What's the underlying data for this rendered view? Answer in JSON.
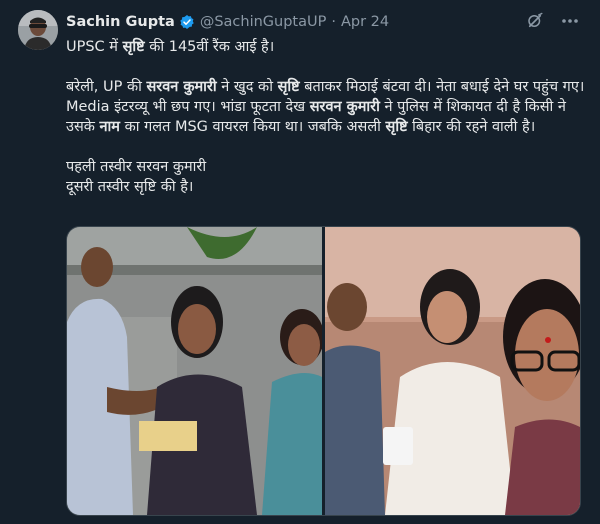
{
  "tweet": {
    "author_name": "Sachin Gupta",
    "handle": "@SachinGuptaUP",
    "separator": "·",
    "date": "Apr 24",
    "line1_a": "UPSC में ",
    "line1_b": "सृष्टि",
    "line1_c": " की 145वीं रैंक आई है।",
    "p2": [
      {
        "t": "बरेली, UP की ",
        "b": false
      },
      {
        "t": "सरवन कुमारी",
        "b": true
      },
      {
        "t": " ने खुद को ",
        "b": false
      },
      {
        "t": "सृष्टि",
        "b": true
      },
      {
        "t": " बताकर मिठाई बंटवा दी। नेता बधाई देने घर पहुंच गए। Media इंटरव्यू भी छप गए। भांडा फूटता देख ",
        "b": false
      },
      {
        "t": "सरवन कुमारी",
        "b": true
      },
      {
        "t": " ने पुलिस में शिकायत दी है किसी ने उसके ",
        "b": false
      },
      {
        "t": "नाम",
        "b": true
      },
      {
        "t": " का गलत MSG वायरल किया था। जबकि असली ",
        "b": false
      },
      {
        "t": "सृष्टि",
        "b": true
      },
      {
        "t": " बिहार की रहने वाली है।",
        "b": false
      }
    ],
    "line3": "पहली तस्वीर सरवन कुमारी",
    "line4": "दूसरी तस्वीर सृष्टि की है।"
  },
  "icons": {
    "verified": "verified-badge-icon",
    "grok": "grok-icon",
    "more": "more-icon"
  },
  "colors": {
    "background": "#15202b",
    "verified": "#1d9bf0",
    "secondary_text": "#8b98a5"
  }
}
